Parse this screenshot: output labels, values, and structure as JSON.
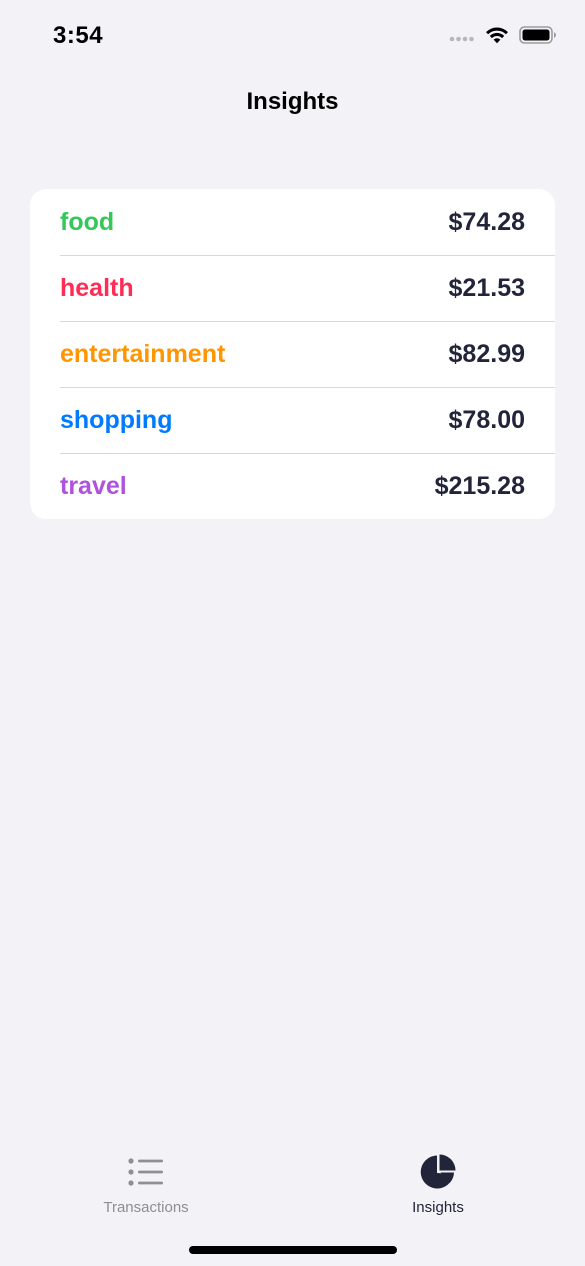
{
  "status_bar": {
    "time": "3:54"
  },
  "nav": {
    "title": "Insights"
  },
  "categories": [
    {
      "label": "food",
      "amount": "$74.28",
      "color": "#34c759"
    },
    {
      "label": "health",
      "amount": "$21.53",
      "color": "#ff2d55"
    },
    {
      "label": "entertainment",
      "amount": "$82.99",
      "color": "#ff9500"
    },
    {
      "label": "shopping",
      "amount": "$78.00",
      "color": "#007aff"
    },
    {
      "label": "travel",
      "amount": "$215.28",
      "color": "#af52de"
    }
  ],
  "tab_bar": {
    "tabs": [
      {
        "label": "Transactions",
        "icon": "list-icon",
        "selected": false
      },
      {
        "label": "Insights",
        "icon": "pie-chart-icon",
        "selected": true
      }
    ]
  },
  "colors": {
    "background": "#f2f2f7",
    "card": "#ffffff",
    "amount_text": "#22253a",
    "tab_selected": "#22253a",
    "tab_unselected": "#8e8e93"
  }
}
